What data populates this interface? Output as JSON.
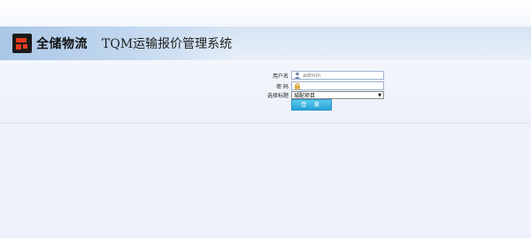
{
  "brand": {
    "company": "全储物流",
    "system_title": "TQM运输报价管理系统"
  },
  "login": {
    "username_label": "用户名",
    "username_value": "admin",
    "password_label": "密 码",
    "project_label": "选择标题",
    "project_selected": "城配项目",
    "login_button": "登 录"
  },
  "colors": {
    "accent": "#27a2d6",
    "logo_red": "#e63b1e",
    "header_blue": "#a9c6e6"
  }
}
